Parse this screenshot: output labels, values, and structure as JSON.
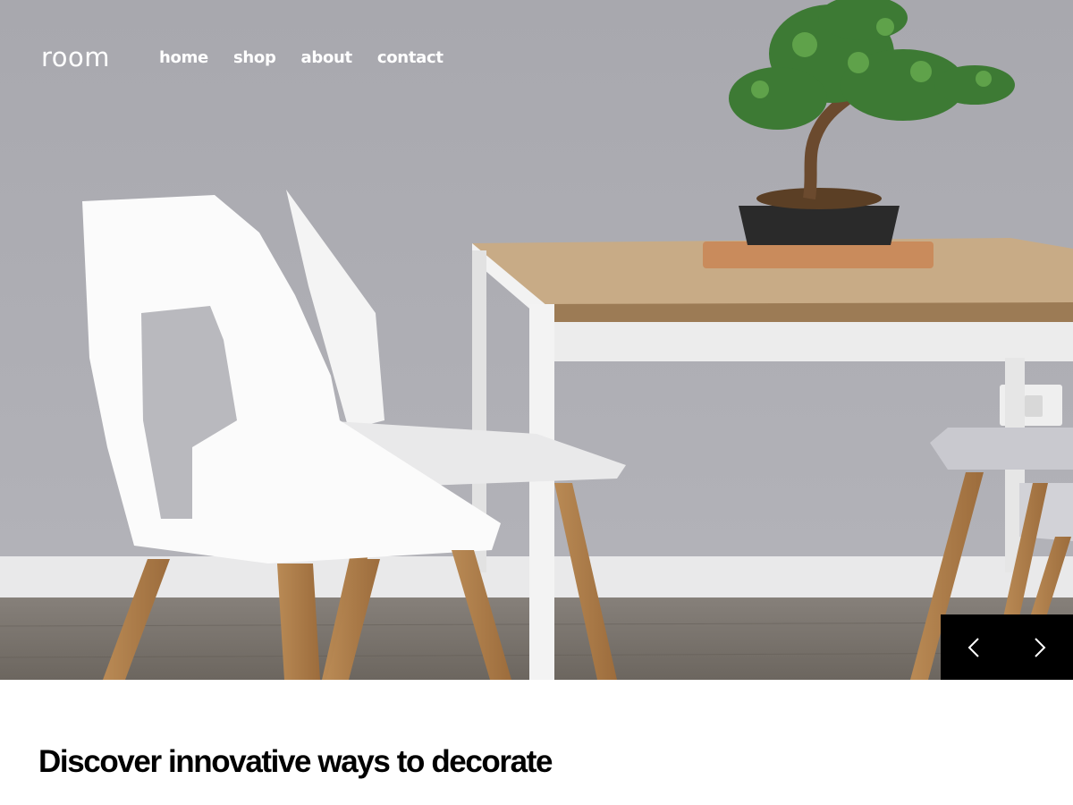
{
  "header": {
    "logo": "room",
    "nav": [
      {
        "label": "home"
      },
      {
        "label": "shop"
      },
      {
        "label": "about"
      },
      {
        "label": "contact"
      }
    ]
  },
  "hero": {
    "image_subject": "white chairs beside a wooden dining table with a bonsai plant",
    "controls": {
      "prev_icon": "chevron-left-icon",
      "next_icon": "chevron-right-icon"
    }
  },
  "content": {
    "headline": "Discover innovative ways to decorate",
    "body": ""
  },
  "colors": {
    "wall": "#a9a9b0",
    "floor": "#7a746d",
    "control_bg": "#000000",
    "headline": "#000000",
    "body_text": "#7d7d85"
  }
}
